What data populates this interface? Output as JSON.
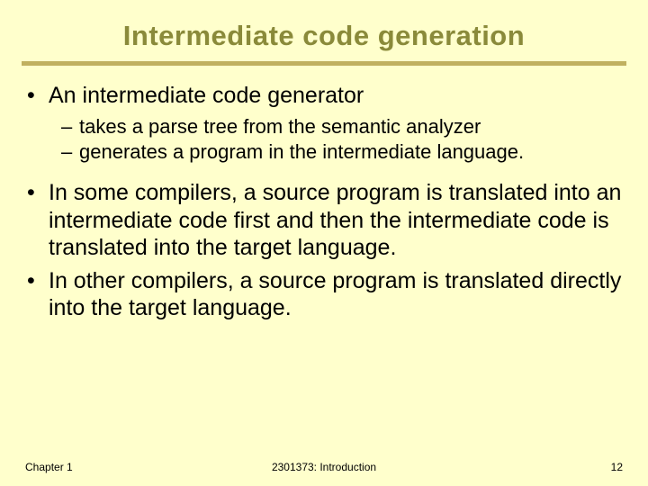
{
  "title": "Intermediate code generation",
  "bullets": {
    "b1": "An intermediate code generator",
    "b1s1": "takes a parse tree from the semantic analyzer",
    "b1s2": "generates a program in the intermediate language.",
    "b2": "In some compilers, a source program is translated into an intermediate code first and then the intermediate code is translated into the target language.",
    "b3": "In other compilers, a source program is translated directly into the target language."
  },
  "footer": {
    "left": "Chapter 1",
    "center": "2301373: Introduction",
    "right": "12"
  }
}
